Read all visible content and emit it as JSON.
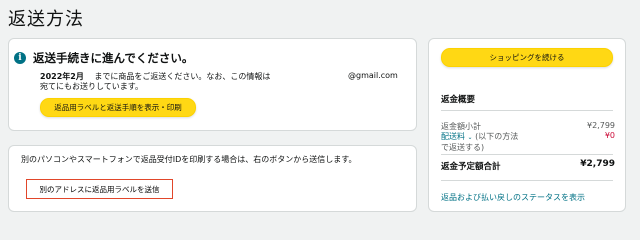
{
  "page": {
    "title": "返送方法"
  },
  "instructions": {
    "heading": "返送手続きに進んでください。",
    "line1_date": "2022年2月",
    "line1_text": "までに商品をご返送ください。なお、この情報は",
    "email": "@gmail.com",
    "line2_text": "宛てにもお送りしています。",
    "button_label": "返品用ラベルと返送手順を表示・印刷"
  },
  "resend": {
    "text": "別のパソコンやスマートフォンで返品受付IDを印刷する場合は、右のボタンから送信します。",
    "button_label": "別のアドレスに返品用ラベルを送信"
  },
  "summary": {
    "continue_button": "ショッピングを続ける",
    "title": "返金概要",
    "subtotal_label": "返金額小計",
    "subtotal_value": "¥2,799",
    "shipping_label_link": "配送料",
    "shipping_label_rest": "(以下の方法",
    "shipping_label_line2": "で返送する)",
    "shipping_value": "¥0",
    "total_label": "返金予定額合計",
    "total_value": "¥2,799",
    "status_link": "返品および払い戻しのステータスを表示"
  },
  "colors": {
    "accent_yellow": "#ffd814",
    "link_teal": "#007185",
    "price_red": "#cc0c39",
    "highlight_border": "#e1462a"
  }
}
